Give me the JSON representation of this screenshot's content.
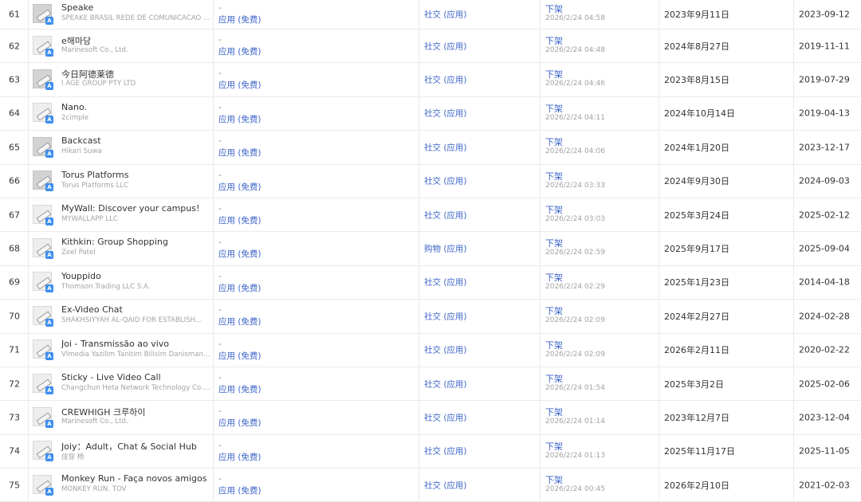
{
  "table": {
    "store_badge": "A",
    "rows": [
      {
        "rank": "61",
        "name": "Speake",
        "developer": "SPEAKE BRASIL REDE DE COMUNICACAO ...",
        "price_dash": "-",
        "price": "应用 (免费)",
        "category": "社交 (应用)",
        "status": "下架",
        "status_time": "2026/2/24 04:58",
        "release": "2023年9月11日",
        "updated": "2023-09-12",
        "icon": "placeholder-dark"
      },
      {
        "rank": "62",
        "name": "e해마당",
        "developer": "Marinesoft Co., Ltd.",
        "price_dash": "-",
        "price": "应用 (免费)",
        "category": "社交 (应用)",
        "status": "下架",
        "status_time": "2026/2/24 04:48",
        "release": "2024年8月27日",
        "updated": "2019-11-11",
        "icon": "placeholder-light"
      },
      {
        "rank": "63",
        "name": "今日阿德莱德",
        "developer": "I AGE GROUP PTY LTD",
        "price_dash": "-",
        "price": "应用 (免费)",
        "category": "社交 (应用)",
        "status": "下架",
        "status_time": "2026/2/24 04:46",
        "release": "2023年8月15日",
        "updated": "2019-07-29",
        "icon": "placeholder-dark"
      },
      {
        "rank": "64",
        "name": "Nano.",
        "developer": "2cimple",
        "price_dash": "-",
        "price": "应用 (免费)",
        "category": "社交 (应用)",
        "status": "下架",
        "status_time": "2026/2/24 04:11",
        "release": "2024年10月14日",
        "updated": "2019-04-13",
        "icon": "placeholder-light"
      },
      {
        "rank": "65",
        "name": "Backcast",
        "developer": "Hikari Suwa",
        "price_dash": "-",
        "price": "应用 (免费)",
        "category": "社交 (应用)",
        "status": "下架",
        "status_time": "2026/2/24 04:06",
        "release": "2024年1月20日",
        "updated": "2023-12-17",
        "icon": "placeholder-dark"
      },
      {
        "rank": "66",
        "name": "Torus Platforms",
        "developer": "Torus Platforms LLC",
        "price_dash": "-",
        "price": "应用 (免费)",
        "category": "社交 (应用)",
        "status": "下架",
        "status_time": "2026/2/24 03:33",
        "release": "2024年9月30日",
        "updated": "2024-09-03",
        "icon": "placeholder-dark"
      },
      {
        "rank": "67",
        "name": "MyWall: Discover your campus!",
        "developer": "MYWALLAPP LLC",
        "price_dash": "-",
        "price": "应用 (免费)",
        "category": "社交 (应用)",
        "status": "下架",
        "status_time": "2026/2/24 03:03",
        "release": "2025年3月24日",
        "updated": "2025-02-12",
        "icon": "placeholder-light"
      },
      {
        "rank": "68",
        "name": "Kithkin: Group Shopping",
        "developer": "Zeel Patel",
        "price_dash": "-",
        "price": "应用 (免费)",
        "category": "购物 (应用)",
        "status": "下架",
        "status_time": "2026/2/24 02:59",
        "release": "2025年9月17日",
        "updated": "2025-09-04",
        "icon": "placeholder-light"
      },
      {
        "rank": "69",
        "name": "Youppido",
        "developer": "Thomson Trading LLC S.A.",
        "price_dash": "-",
        "price": "应用 (免费)",
        "category": "社交 (应用)",
        "status": "下架",
        "status_time": "2026/2/24 02:29",
        "release": "2025年1月23日",
        "updated": "2014-04-18",
        "icon": "placeholder-light"
      },
      {
        "rank": "70",
        "name": "Ex-Video Chat",
        "developer": "SHAKHSIYYAH AL-QAID FOR ESTABLISH...",
        "price_dash": "-",
        "price": "应用 (免费)",
        "category": "社交 (应用)",
        "status": "下架",
        "status_time": "2026/2/24 02:09",
        "release": "2024年2月27日",
        "updated": "2024-02-28",
        "icon": "placeholder-light"
      },
      {
        "rank": "71",
        "name": "Joi - Transmissão ao vivo",
        "developer": "Vlmedia Yazilim Tanitim Bilisim Danismanlik...",
        "price_dash": "-",
        "price": "应用 (免费)",
        "category": "社交 (应用)",
        "status": "下架",
        "status_time": "2026/2/24 02:09",
        "release": "2026年2月11日",
        "updated": "2020-02-22",
        "icon": "placeholder-light"
      },
      {
        "rank": "72",
        "name": "Sticky - Live Video Call",
        "developer": "Changchun Heta Network Technology Co., L...",
        "price_dash": "-",
        "price": "应用 (免费)",
        "category": "社交 (应用)",
        "status": "下架",
        "status_time": "2026/2/24 01:54",
        "release": "2025年3月2日",
        "updated": "2025-02-06",
        "icon": "placeholder-light"
      },
      {
        "rank": "73",
        "name": "CREWHIGH 크루하이",
        "developer": "Marinesoft Co., Ltd.",
        "price_dash": "-",
        "price": "应用 (免费)",
        "category": "社交 (应用)",
        "status": "下架",
        "status_time": "2026/2/24 01:14",
        "release": "2023年12月7日",
        "updated": "2023-12-04",
        "icon": "placeholder-light"
      },
      {
        "rank": "74",
        "name": "Joiy：Adult，Chat & Social Hub",
        "developer": "佳穿 杨",
        "price_dash": "-",
        "price": "应用 (免费)",
        "category": "社交 (应用)",
        "status": "下架",
        "status_time": "2026/2/24 01:13",
        "release": "2025年11月17日",
        "updated": "2025-11-05",
        "icon": "placeholder-light"
      },
      {
        "rank": "75",
        "name": "Monkey Run - Faça novos amigos",
        "developer": "MONKEY RUN. TOV",
        "price_dash": "-",
        "price": "应用 (免费)",
        "category": "社交 (应用)",
        "status": "下架",
        "status_time": "2026/2/24 00:45",
        "release": "2026年2月10日",
        "updated": "2021-02-03",
        "icon": "placeholder-light"
      }
    ]
  }
}
